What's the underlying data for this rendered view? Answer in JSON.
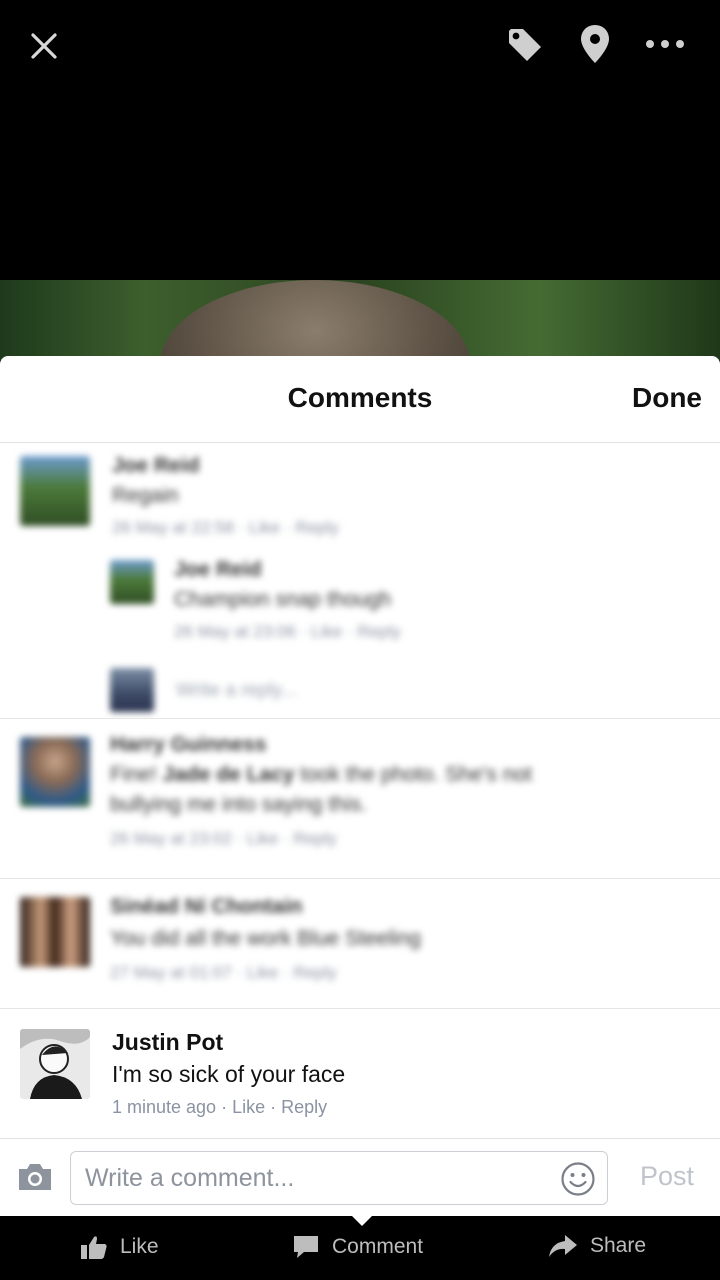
{
  "sheet": {
    "title": "Comments",
    "done_label": "Done"
  },
  "comments": [
    {
      "name": "Joe Reid",
      "text": "Regain",
      "meta": "26 May at 22:58 · Like · Reply"
    },
    {
      "name": "Joe Reid",
      "text": "Champion snap though",
      "meta": "26 May at 23:06 · Like · Reply"
    },
    {
      "reply_placeholder": "Write a reply..."
    },
    {
      "name": "Harry Guinness",
      "text_line1_pre": "Fine! ",
      "text_line1_tag": "Jade de Lacy",
      "text_line1_post": " took the photo. She's not",
      "text_line2": "bullying me into saying this.",
      "meta": "26 May at 23:02 · Like · Reply"
    },
    {
      "name": "Sinéad Ní Chontain",
      "text": "You did all the work Blue Steeling",
      "meta": "27 May at 01:07 · Like · Reply"
    },
    {
      "name": "Justin Pot",
      "text": "I'm so sick of your face",
      "time": "1 minute ago",
      "like": "Like",
      "reply": "Reply"
    }
  ],
  "composer": {
    "placeholder": "Write a comment...",
    "post_label": "Post"
  },
  "actions": {
    "like": "Like",
    "comment": "Comment",
    "share": "Share"
  },
  "icons": [
    "close-icon",
    "tag-icon",
    "location-pin-icon",
    "more-icon",
    "camera-icon",
    "emoji-icon",
    "thumbs-up-icon",
    "speech-bubble-icon",
    "share-arrow-icon"
  ]
}
